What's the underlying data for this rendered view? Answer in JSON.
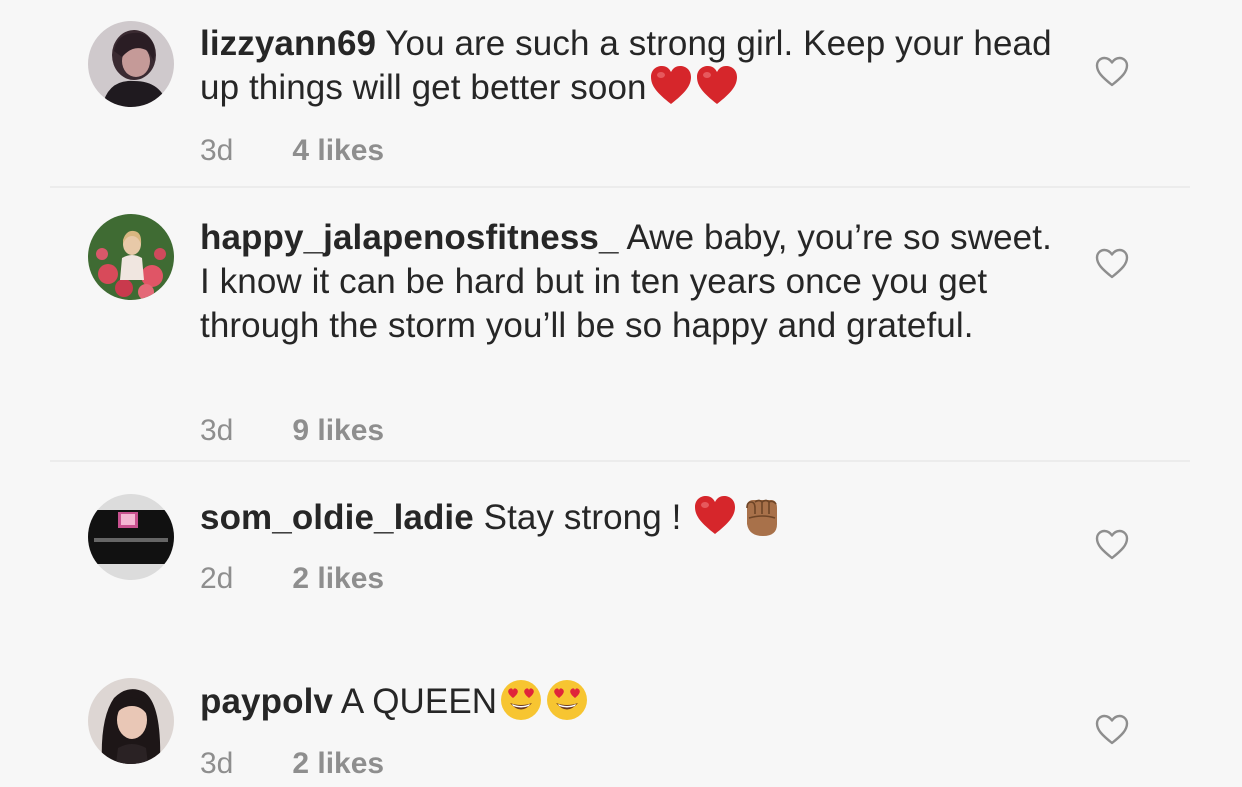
{
  "comments": [
    {
      "username": "lizzyann69",
      "text": "You are such a strong girl. Keep your head up things will get better soon",
      "emojis": [
        "red-heart",
        "red-heart"
      ],
      "time": "3d",
      "likes": "4 likes"
    },
    {
      "username": "happy_jalapenosfitness_",
      "text": "Awe baby, you’re so sweet. I know it can be hard but in ten years once you get through the storm you’ll be so happy and grateful.",
      "emojis": [],
      "time": "3d",
      "likes": "9 likes"
    },
    {
      "username": "som_oldie_ladie",
      "text": "Stay strong !",
      "emojis": [
        "red-heart",
        "raised-fist-medium-dark"
      ],
      "time": "2d",
      "likes": "2 likes"
    },
    {
      "username": "paypolv",
      "text": "A QUEEN",
      "emojis": [
        "heart-eyes-face",
        "heart-eyes-face"
      ],
      "time": "3d",
      "likes": "2 likes"
    }
  ],
  "colors": {
    "background": "#f7f7f7",
    "text": "#262626",
    "meta": "#8e8e8e",
    "heart_emoji": "#d6262b",
    "like_icon": "#8e8e8e"
  },
  "icons": {
    "like": "heart-outline-icon"
  }
}
